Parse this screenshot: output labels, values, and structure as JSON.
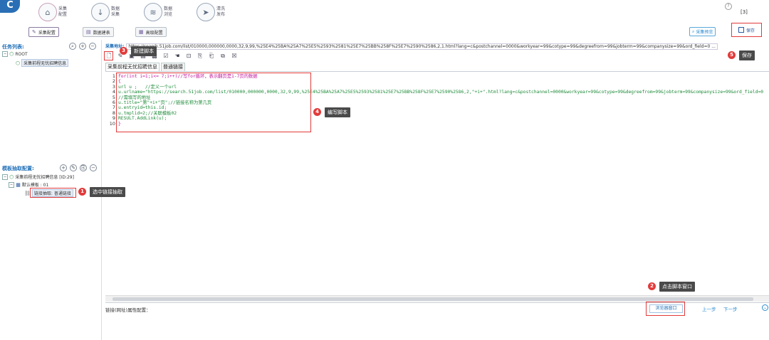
{
  "app": {
    "logo": "C"
  },
  "nav": [
    {
      "icon": "home-icon",
      "glyph": "⌂",
      "line1": "采集",
      "line2": "配置"
    },
    {
      "icon": "download-icon",
      "glyph": "↓",
      "line1": "数据",
      "line2": "采集"
    },
    {
      "icon": "database-icon",
      "glyph": "≋",
      "line1": "数据",
      "line2": "浏览"
    },
    {
      "icon": "publish-icon",
      "glyph": "➤",
      "line1": "清洗",
      "line2": "发布"
    }
  ],
  "header": {
    "help": "?",
    "counter": "[3]"
  },
  "subtoolbar": {
    "collect_config": "采集配置",
    "data_table": "数据建表",
    "advanced_config": "高级配置",
    "preview": "采集预览",
    "save": "保存"
  },
  "tasklist": {
    "title": "任务列表:",
    "root": "ROOT",
    "task": "采集前程无忧招聘信息"
  },
  "template": {
    "title": "模板抽取配置:",
    "task": "采集前程无忧招聘信息 [ID:29]",
    "template": "默认模板 : 01",
    "link_extract": "链接抽取: 普通链接"
  },
  "editor": {
    "url_label": "采集地址:",
    "url_value": "https://search.51job.com/list/010000,000000,0000,32,9,99,%25E4%25BA%25A7%25E5%2593%2581%25E7%25BB%258F%25E7%2590%2586,2,1.html?lang=c&postchannel=0000&workyear=99&cotype=99&degreefrom=99&jobterm=99&companysize=99&ord_field=0 ...",
    "tabs": [
      "采集前程无忧招聘信息",
      "普通链接"
    ],
    "lines": [
      {
        "n": "1",
        "text": "for(int i=1;i<= 7;i++)//写for循环，表示翻页是1-7页的数据",
        "color": "#c0179b"
      },
      {
        "n": "2",
        "text": "{",
        "color": "#c0179b"
      },
      {
        "n": "3",
        "text": "url u ;   //定义一个url",
        "color": "#1f8c3a"
      },
      {
        "n": "4",
        "text": "u.urlname=\"https://search.51job.com/list/010000,000000,0000,32,9,99,%25E4%25BA%25A7%25E5%2593%2581%25E7%25BB%258F%25E7%2590%2586,2,\"+i+\".html?lang=c&postchannel=0000&workyear=99&cotype=99&degreefrom=99&jobterm=99&companysize=99&ord_field=0",
        "color": "#1f8c3a"
      },
      {
        "n": "5",
        "text": "//需填写的地址",
        "color": "#1f8c3a"
      },
      {
        "n": "6",
        "text": "u.title=\"第\"+i+\"页\";//链接名称为第几页",
        "color": "#1f8c3a"
      },
      {
        "n": "7",
        "text": "u.entryid=this.id;",
        "color": "#1f8c3a"
      },
      {
        "n": "8",
        "text": "u.tmplid=2;//关联模板02",
        "color": "#1f8c3a"
      },
      {
        "n": "9",
        "text": "RESULT.AddLink(u);",
        "color": "#1f8c3a"
      },
      {
        "n": "10",
        "text": "}",
        "color": "#c0179b"
      }
    ]
  },
  "bottom": {
    "link_attr": "链接(网址)属性配置：",
    "script_window": "浏览器窗口",
    "prev": "上一步",
    "next": "下一步"
  },
  "annotations": {
    "a1": {
      "n": "1",
      "text": "选中链接抽取"
    },
    "a2": {
      "n": "2",
      "text": "点击脚本窗口"
    },
    "a3": {
      "n": "3",
      "text": "新建脚本"
    },
    "a4": {
      "n": "4",
      "text": "编写脚本"
    },
    "a5": {
      "n": "5",
      "text": "保存"
    }
  },
  "colors": {
    "accent": "#1f6fb8",
    "annotation": "#e23b3b"
  }
}
